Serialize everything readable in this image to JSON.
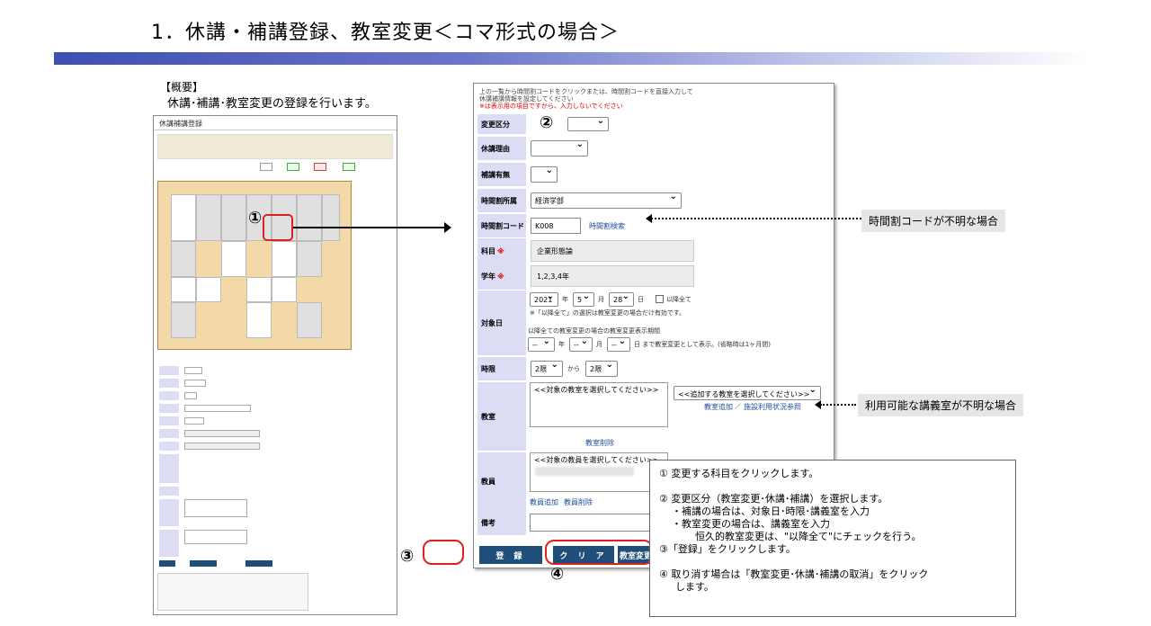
{
  "slide": {
    "title": "1．休講・補講登録、教室変更＜コマ形式の場合＞",
    "overview_heading": "【概要】",
    "overview_text": "休講･補講･教室変更の登録を行います。"
  },
  "thumbnail": {
    "window_title": "休講補講登録"
  },
  "markers": {
    "m1": "①",
    "m2": "②",
    "m3": "③",
    "m4": "④"
  },
  "form": {
    "intro_line1": "上の一覧から時間割コードをクリックまたは、時間割コードを直接入力して",
    "intro_line2": "休講補講情報を設定してください",
    "intro_line3": "※は表示用の項目ですから、入力しないでください",
    "change_type": {
      "label": "変更区分",
      "value": ""
    },
    "cancel_reason": {
      "label": "休講理由",
      "value": ""
    },
    "makeup": {
      "label": "補講有無",
      "value": ""
    },
    "affiliation": {
      "label": "時間割所属",
      "value": "経済学部"
    },
    "timetable_code": {
      "label": "時間割コード",
      "value": "K008",
      "search_link": "時間割検索"
    },
    "subject": {
      "label": "科目",
      "mark": "※",
      "value": "企業形態論"
    },
    "grade": {
      "label": "学年",
      "mark": "※",
      "value": "1,2,3,4年"
    },
    "target_date": {
      "label": "対象日",
      "year": "2021",
      "year_unit": "年",
      "month": "5",
      "month_unit": "月",
      "day": "28",
      "day_unit": "日",
      "all_after": "以降全て",
      "note": "※「以降全て」の選択は教室変更の場合だけ有効です。",
      "period_title": "以降全ての教室変更の場合の教室変更表示期間",
      "from_year": "--",
      "from_month": "--",
      "to_day": "--",
      "period_suffix": "日 まで教室変更として表示。(省略時は1ヶ月間)"
    },
    "period": {
      "label": "時限",
      "from": "2限",
      "kara": "から",
      "to": "2限"
    },
    "classroom": {
      "label": "教室",
      "target_placeholder": "<<対象の教室を選択してください>>",
      "add_placeholder": "<<追加する教室を選択してください>>",
      "add_link": "教室追加",
      "separator": "／",
      "facility_link": "施設利用状況参照",
      "delete_link": "教室削除"
    },
    "teacher": {
      "label": "教員",
      "target_placeholder": "<<対象の教員を選択してください>>",
      "add_link": "教員追加",
      "delete_link": "教員削除"
    },
    "remarks": {
      "label": "備考",
      "value": ""
    },
    "buttons": {
      "register": "登 録",
      "clear": "ク リ ア",
      "room_change": "教室変更"
    }
  },
  "callouts": {
    "unknown_code": "時間割コードが不明な場合",
    "unknown_room": "利用可能な講義室が不明な場合"
  },
  "notes": {
    "n1": "① 変更する科目をクリックします。",
    "n2": "② 変更区分（教室変更･休講･補講）を選択します。",
    "n2a": "・補講の場合は、対象日･時限･講義室を入力",
    "n2b": "・教室変更の場合は、講義室を入力",
    "n2c": "恒久的教室変更は、\"以降全て\"にチェックを行う。",
    "n3": "③「登録」をクリックします。",
    "n4a": "④ 取り消す場合は「教室変更･休講･補講の取消」をクリック",
    "n4b": "します。"
  }
}
